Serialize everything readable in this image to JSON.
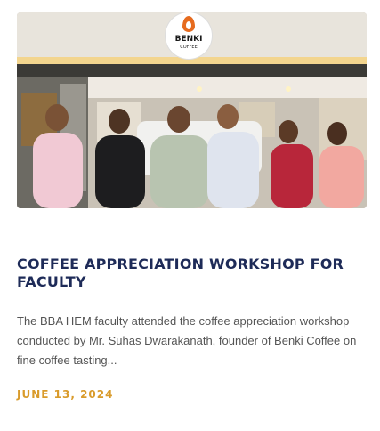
{
  "post": {
    "image_alt": "Faculty group photo in front of Benki Coffee",
    "logo": {
      "brand": "BENKI",
      "sub": "COFFEE",
      "icon": "flame-icon"
    },
    "title": "COFFEE APPRECIATION WORKSHOP FOR FACULTY",
    "excerpt": "The BBA HEM faculty attended the coffee appreciation workshop conducted by Mr. Suhas Dwarakanath, founder of Benki Coffee on fine coffee tasting...",
    "date": "JUNE 13, 2024"
  },
  "colors": {
    "title": "#1e2b58",
    "date": "#d99b2b",
    "text": "#555555"
  }
}
